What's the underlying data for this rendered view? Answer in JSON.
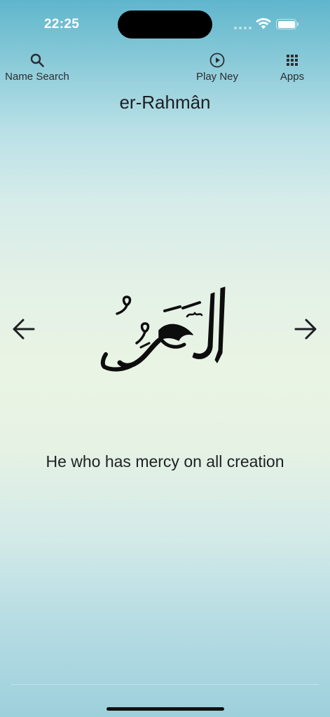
{
  "status": {
    "time": "22:25"
  },
  "toolbar": {
    "search_label": "Name Search",
    "ney_label": "Play Ney",
    "apps_label": "Apps"
  },
  "name": {
    "title": "er-Rahmân",
    "arabic": "الرَّحْمٰنُ",
    "meaning": "He who has mercy on all creation"
  },
  "icons": {
    "search": "search-icon",
    "play": "play-circle-icon",
    "apps": "grid-icon",
    "prev": "arrow-left-icon",
    "next": "arrow-right-icon"
  },
  "colors": {
    "gradient_top": "#5fb6cc",
    "gradient_mid": "#e9f4e4",
    "gradient_bottom": "#9dd0dc",
    "text": "#1d1f22"
  }
}
